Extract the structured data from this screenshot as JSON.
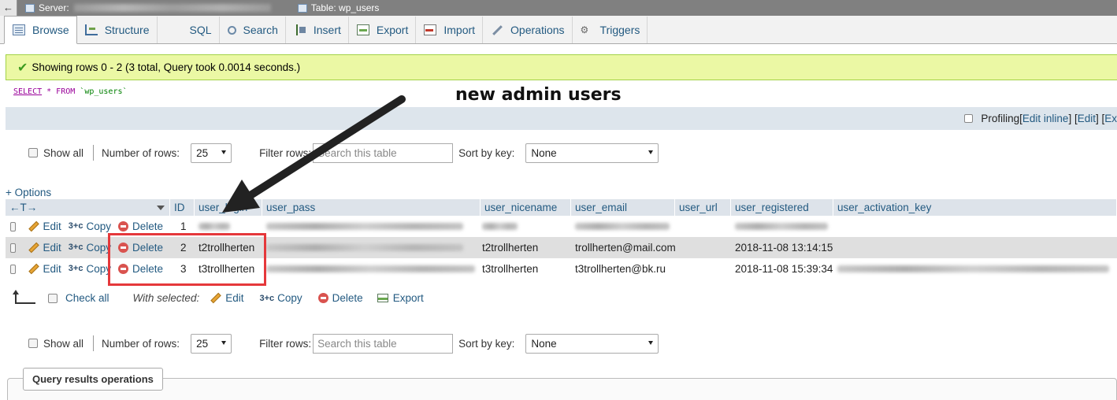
{
  "topbar": {
    "back_glyph": "←",
    "server_label": "Server:",
    "table_label": "Table: wp_users"
  },
  "tabs": [
    {
      "label": "Browse",
      "icon": "browse-icon",
      "active": true
    },
    {
      "label": "Structure",
      "icon": "structure-icon"
    },
    {
      "label": "SQL",
      "icon": "sql-icon"
    },
    {
      "label": "Search",
      "icon": "search-icon"
    },
    {
      "label": "Insert",
      "icon": "insert-icon"
    },
    {
      "label": "Export",
      "icon": "export-icon"
    },
    {
      "label": "Import",
      "icon": "import-icon"
    },
    {
      "label": "Operations",
      "icon": "operations-icon"
    },
    {
      "label": "Triggers",
      "icon": "triggers-icon"
    }
  ],
  "message": {
    "text": "Showing rows 0 - 2 (3 total, Query took 0.0014 seconds.)"
  },
  "query": {
    "select": "SELECT",
    "rest": " * FROM ",
    "table": "`wp_users`"
  },
  "toolstrip": {
    "profiling": "Profiling",
    "open1": " [",
    "edit_inline": "Edit inline",
    "mid": "] [ ",
    "edit": "Edit",
    "mid2": " ] [ ",
    "explain": "Ex"
  },
  "nav": {
    "show_all": "Show all",
    "number_of_rows": "Number of rows:",
    "rows_value": "25",
    "filter_rows": "Filter rows:",
    "filter_placeholder": "Search this table",
    "sort_by_key": "Sort by key:",
    "sort_value": "None"
  },
  "options_label": "+ Options",
  "columns": [
    "ID",
    "user_login",
    "user_pass",
    "user_nicename",
    "user_email",
    "user_url",
    "user_registered",
    "user_activation_key"
  ],
  "actions": {
    "edit": "Edit",
    "copy": "Copy",
    "delete": "Delete"
  },
  "rows": [
    {
      "id": "1",
      "user_login": "",
      "user_pass": "",
      "user_nicename": "",
      "user_email": "",
      "user_url": "",
      "user_registered": "",
      "user_activation_key": ""
    },
    {
      "id": "2",
      "user_login": "t2trollherten",
      "user_pass": "",
      "user_nicename": "t2trollherten",
      "user_email": "trollherten@mail.com",
      "user_url": "",
      "user_registered": "2018-11-08 13:14:15",
      "user_activation_key": ""
    },
    {
      "id": "3",
      "user_login": "t3trollherten",
      "user_pass": "",
      "user_nicename": "t3trollherten",
      "user_email": "t3trollherten@bk.ru",
      "user_url": "",
      "user_registered": "2018-11-08 15:39:34",
      "user_activation_key": ""
    }
  ],
  "with_selected": {
    "check_all": "Check all",
    "label": "With selected:",
    "edit": "Edit",
    "copy": "Copy",
    "delete": "Delete",
    "export": "Export"
  },
  "query_results_operations": "Query results operations",
  "annotation": {
    "text": "new admin users",
    "color": "#e5383b"
  }
}
